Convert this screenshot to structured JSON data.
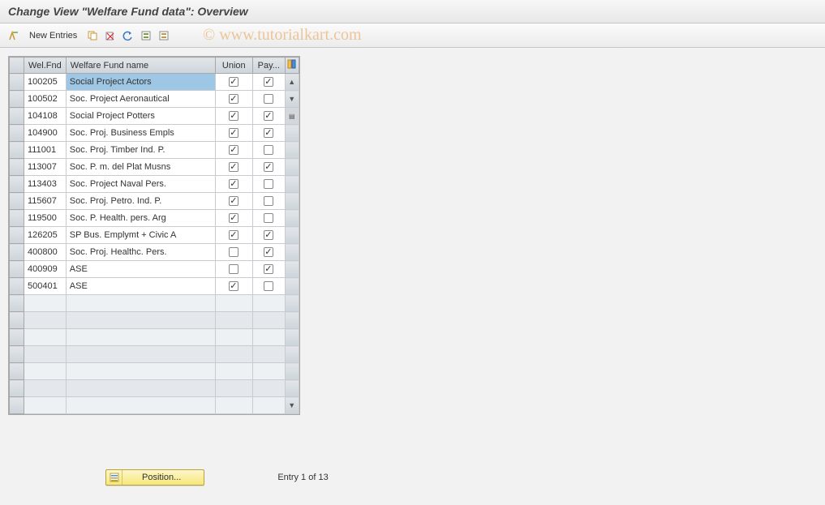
{
  "title": "Change View \"Welfare Fund data\": Overview",
  "watermark": "© www.tutorialkart.com",
  "toolbar": {
    "new_entries": "New Entries"
  },
  "table": {
    "headers": {
      "code": "Wel.Fnd",
      "name": "Welfare Fund name",
      "union": "Union",
      "pay": "Pay..."
    },
    "rows": [
      {
        "code": "100205",
        "name": "Social Project Actors",
        "union": true,
        "pay": true,
        "hl": true
      },
      {
        "code": "100502",
        "name": "Soc. Project Aeronautical",
        "union": true,
        "pay": false
      },
      {
        "code": "104108",
        "name": "Social Project Potters",
        "union": true,
        "pay": true
      },
      {
        "code": "104900",
        "name": "Soc. Proj. Business Empls",
        "union": true,
        "pay": true
      },
      {
        "code": "111001",
        "name": "Soc. Proj. Timber Ind. P.",
        "union": true,
        "pay": false
      },
      {
        "code": "113007",
        "name": "Soc. P. m. del Plat Musns",
        "union": true,
        "pay": true
      },
      {
        "code": "113403",
        "name": "Soc. Project Naval Pers.",
        "union": true,
        "pay": false
      },
      {
        "code": "115607",
        "name": "Soc. Proj. Petro. Ind. P.",
        "union": true,
        "pay": false
      },
      {
        "code": "119500",
        "name": "Soc. P. Health. pers. Arg",
        "union": true,
        "pay": false
      },
      {
        "code": "126205",
        "name": "SP Bus. Emplymt + Civic A",
        "union": true,
        "pay": true
      },
      {
        "code": "400800",
        "name": "Soc. Proj. Healthc. Pers.",
        "union": false,
        "pay": true
      },
      {
        "code": "400909",
        "name": "ASE",
        "union": false,
        "pay": true
      },
      {
        "code": "500401",
        "name": "ASE",
        "union": true,
        "pay": false
      }
    ],
    "empty_rows": 7
  },
  "footer": {
    "position_label": "Position...",
    "status": "Entry 1 of 13"
  }
}
